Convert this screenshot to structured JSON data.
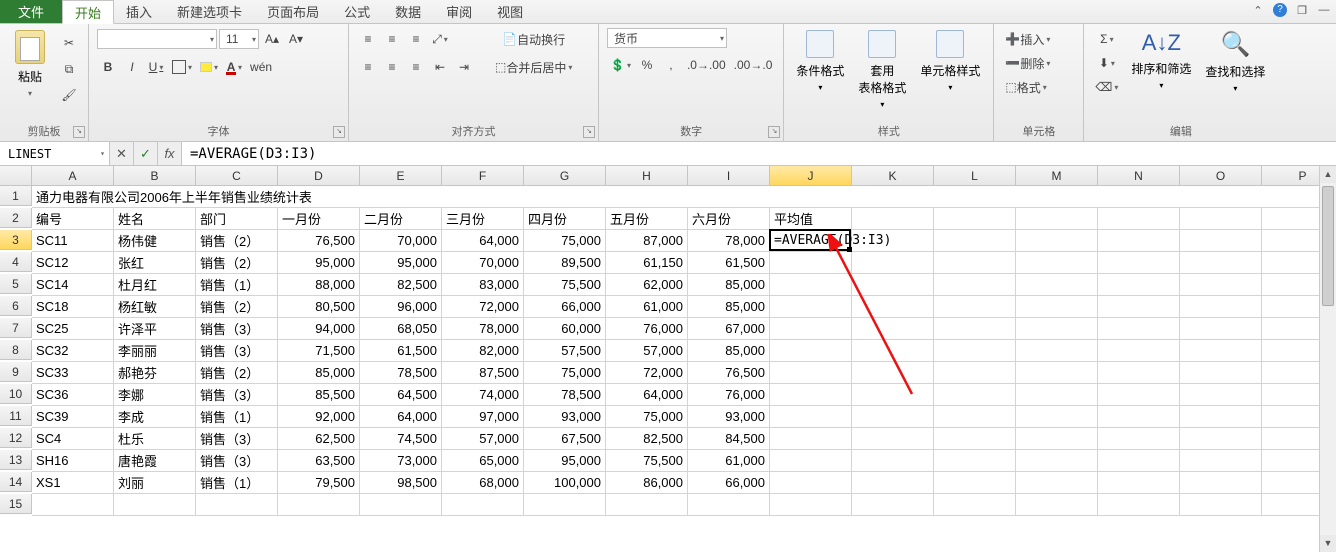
{
  "tabs": {
    "file": "文件",
    "items": [
      "开始",
      "插入",
      "新建选项卡",
      "页面布局",
      "公式",
      "数据",
      "审阅",
      "视图"
    ],
    "active_index": 0
  },
  "ribbon": {
    "clipboard": {
      "paste": "粘贴",
      "label": "剪贴板"
    },
    "font": {
      "label": "字体",
      "size_value": "11",
      "bold": "B",
      "italic": "I",
      "underline": "U"
    },
    "alignment": {
      "label": "对齐方式",
      "wrap": "自动换行",
      "merge": "合并后居中"
    },
    "number": {
      "label": "数字",
      "format_value": "货币"
    },
    "styles": {
      "label": "样式",
      "cond": "条件格式",
      "table": "套用\n表格格式",
      "cell": "单元格样式"
    },
    "cells": {
      "label": "单元格",
      "insert": "插入",
      "delete": "删除",
      "format": "格式"
    },
    "editing": {
      "label": "编辑",
      "sort": "排序和筛选",
      "find": "查找和选择"
    }
  },
  "formula_bar": {
    "name_box": "LINEST",
    "cancel": "✕",
    "enter": "✓",
    "fx": "fx",
    "formula": "=AVERAGE(D3:I3)"
  },
  "columns": [
    "A",
    "B",
    "C",
    "D",
    "E",
    "F",
    "G",
    "H",
    "I",
    "J",
    "K",
    "L",
    "M",
    "N",
    "O",
    "P"
  ],
  "title_row": "通力电器有限公司2006年上半年销售业绩统计表",
  "headers_row": [
    "编号",
    "姓名",
    "部门",
    "一月份",
    "二月份",
    "三月份",
    "四月份",
    "五月份",
    "六月份",
    "平均值"
  ],
  "active_cell_text": "=AVERAGE(D3:I3)",
  "rows": [
    {
      "n": 3,
      "id": "SC11",
      "name": "杨伟健",
      "dept": "销售（2）",
      "m": [
        "76,500",
        "70,000",
        "64,000",
        "75,000",
        "87,000",
        "78,000"
      ]
    },
    {
      "n": 4,
      "id": "SC12",
      "name": "张红",
      "dept": "销售（2）",
      "m": [
        "95,000",
        "95,000",
        "70,000",
        "89,500",
        "61,150",
        "61,500"
      ]
    },
    {
      "n": 5,
      "id": "SC14",
      "name": "杜月红",
      "dept": "销售（1）",
      "m": [
        "88,000",
        "82,500",
        "83,000",
        "75,500",
        "62,000",
        "85,000"
      ]
    },
    {
      "n": 6,
      "id": "SC18",
      "name": "杨红敏",
      "dept": "销售（2）",
      "m": [
        "80,500",
        "96,000",
        "72,000",
        "66,000",
        "61,000",
        "85,000"
      ]
    },
    {
      "n": 7,
      "id": "SC25",
      "name": "许泽平",
      "dept": "销售（3）",
      "m": [
        "94,000",
        "68,050",
        "78,000",
        "60,000",
        "76,000",
        "67,000"
      ]
    },
    {
      "n": 8,
      "id": "SC32",
      "name": "李丽丽",
      "dept": "销售（3）",
      "m": [
        "71,500",
        "61,500",
        "82,000",
        "57,500",
        "57,000",
        "85,000"
      ]
    },
    {
      "n": 9,
      "id": "SC33",
      "name": "郝艳芬",
      "dept": "销售（2）",
      "m": [
        "85,000",
        "78,500",
        "87,500",
        "75,000",
        "72,000",
        "76,500"
      ]
    },
    {
      "n": 10,
      "id": "SC36",
      "name": "李娜",
      "dept": "销售（3）",
      "m": [
        "85,500",
        "64,500",
        "74,000",
        "78,500",
        "64,000",
        "76,000"
      ]
    },
    {
      "n": 11,
      "id": "SC39",
      "name": "李成",
      "dept": "销售（1）",
      "m": [
        "92,000",
        "64,000",
        "97,000",
        "93,000",
        "75,000",
        "93,000"
      ]
    },
    {
      "n": 12,
      "id": "SC4",
      "name": "杜乐",
      "dept": "销售（3）",
      "m": [
        "62,500",
        "74,500",
        "57,000",
        "67,500",
        "82,500",
        "84,500"
      ]
    },
    {
      "n": 13,
      "id": "SH16",
      "name": "唐艳霞",
      "dept": "销售（3）",
      "m": [
        "63,500",
        "73,000",
        "65,000",
        "95,000",
        "75,500",
        "61,000"
      ]
    },
    {
      "n": 14,
      "id": "XS1",
      "name": "刘丽",
      "dept": "销售（1）",
      "m": [
        "79,500",
        "98,500",
        "68,000",
        "100,000",
        "86,000",
        "66,000"
      ]
    }
  ]
}
